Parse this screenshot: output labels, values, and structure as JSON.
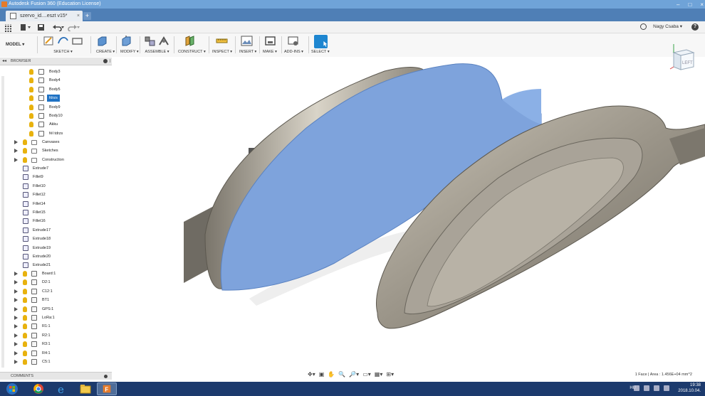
{
  "window": {
    "title": "Autodesk Fusion 360 (Education License)"
  },
  "tab": {
    "label": "szervo_id....eszt v15*",
    "close": "×",
    "add": "+"
  },
  "qat": {
    "user": "Nagy Csaba ▾",
    "help": "?"
  },
  "toolbar": {
    "workspace": "MODEL ▾",
    "groups": [
      {
        "label": "SKETCH ▾"
      },
      {
        "label": "CREATE ▾"
      },
      {
        "label": "MODIFY ▾"
      },
      {
        "label": "ASSEMBLE ▾"
      },
      {
        "label": "CONSTRUCT ▾"
      },
      {
        "label": "INSPECT ▾"
      },
      {
        "label": "INSERT ▾"
      },
      {
        "label": "MAKE ▾"
      },
      {
        "label": "ADD-INS ▾"
      },
      {
        "label": "SELECT ▾"
      }
    ]
  },
  "browser": {
    "title": "BROWSER",
    "nodes": [
      {
        "label": "Body3"
      },
      {
        "label": "Body4"
      },
      {
        "label": "Body5"
      },
      {
        "label": "fdrzs"
      },
      {
        "label": "Body9"
      },
      {
        "label": "Body10"
      },
      {
        "label": "Akku"
      },
      {
        "label": "fél tdrzs"
      },
      {
        "label": "Canvases"
      },
      {
        "label": "Sketches"
      },
      {
        "label": "Construction"
      },
      {
        "label": "Extrude7"
      },
      {
        "label": "Fillet9"
      },
      {
        "label": "Fillet10"
      },
      {
        "label": "Fillet12"
      },
      {
        "label": "Fillet14"
      },
      {
        "label": "Fillet15"
      },
      {
        "label": "Fillet16"
      },
      {
        "label": "Extrude17"
      },
      {
        "label": "Extrude18"
      },
      {
        "label": "Extrude19"
      },
      {
        "label": "Extrude20"
      },
      {
        "label": "Extrude21"
      },
      {
        "label": "Board:1"
      },
      {
        "label": "D2:1"
      },
      {
        "label": "C12:1"
      },
      {
        "label": "BT1"
      },
      {
        "label": "GPS:1"
      },
      {
        "label": "LoRa:1"
      },
      {
        "label": "R1:1"
      },
      {
        "label": "R2:1"
      },
      {
        "label": "R3:1"
      },
      {
        "label": "R4:1"
      },
      {
        "label": "C5:1"
      }
    ]
  },
  "comments": {
    "title": "COMMENTS"
  },
  "viewcube": {
    "face": "LEFT"
  },
  "status": {
    "text": "1 Face | Area : 1.456E+04 mm^2"
  },
  "taskbar": {
    "lang": "HU",
    "time": "19:38",
    "date": "2018.10.04."
  },
  "colors": {
    "selection": "#7ea3dc",
    "body": "#8d877b",
    "accent": "#1f72c4"
  }
}
